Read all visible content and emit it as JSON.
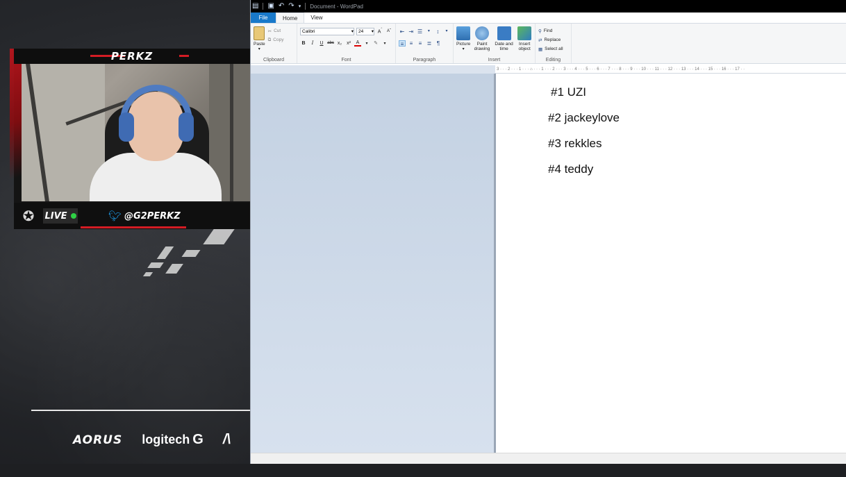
{
  "overlay": {
    "streamer_name": "PERKZ",
    "live_label": "LIVE",
    "twitter_handle": "@G2PERKZ",
    "sponsors": [
      "AORUS",
      "logitech",
      "/\\"
    ]
  },
  "wordpad": {
    "title": "Document - WordPad",
    "tabs": {
      "file": "File",
      "home": "Home",
      "view": "View"
    },
    "clipboard": {
      "paste": "Paste",
      "cut": "Cut",
      "copy": "Copy",
      "label": "Clipboard"
    },
    "font": {
      "family": "Calibri",
      "size": "24",
      "label": "Font"
    },
    "paragraph": {
      "label": "Paragraph"
    },
    "insert": {
      "picture": "Picture",
      "paint_drawing": "Paint drawing",
      "date_time": "Date and time",
      "insert_object": "Insert object",
      "label": "Insert"
    },
    "editing": {
      "find": "Find",
      "replace": "Replace",
      "select_all": "Select all",
      "label": "Editing"
    },
    "ruler_text": "3 · · · 2 · · · 1 · · · ⌂ · · · 1 · · · 2 · · · 3 · · · 4 · · · 5 · · · 6 · · · 7 · · · 8 · · · 9 · · · 10 · · · 11 · · · 12 · · · 13 · · · 14 · · · 15 · · · 16 · · · 17 · ·",
    "document_lines": [
      "#1 UZI",
      "#2 jackeylove",
      "#3 rekkles",
      "#4 teddy"
    ]
  },
  "colors": {
    "accent_red": "#d41c24",
    "live_green": "#2fd045",
    "twitter_blue": "#1da1f2",
    "wordpad_file_tab": "#1979ca"
  }
}
